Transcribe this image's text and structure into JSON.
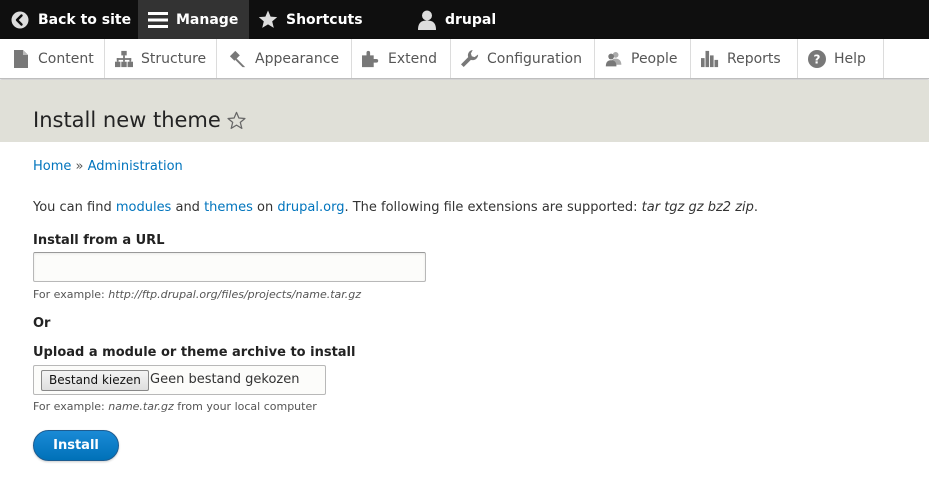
{
  "toolbar": {
    "back_label": "Back to site",
    "manage_label": "Manage",
    "shortcuts_label": "Shortcuts",
    "user_label": "drupal"
  },
  "tray": {
    "content": "Content",
    "structure": "Structure",
    "appearance": "Appearance",
    "extend": "Extend",
    "configuration": "Configuration",
    "people": "People",
    "reports": "Reports",
    "help": "Help"
  },
  "page": {
    "title": "Install new theme"
  },
  "breadcrumb": {
    "home": "Home",
    "separator": "»",
    "admin": "Administration"
  },
  "description": {
    "prefix": "You can find ",
    "modules_link": "modules",
    "and": " and ",
    "themes_link": "themes",
    "on": " on ",
    "drupal_link": "drupal.org",
    "suffix": ". The following file extensions are supported: ",
    "extensions": "tar tgz gz bz2 zip",
    "end": "."
  },
  "form": {
    "url_label": "Install from a URL",
    "url_value": "",
    "url_help_prefix": "For example: ",
    "url_help_example": "http://ftp.drupal.org/files/projects/name.tar.gz",
    "or_label": "Or",
    "upload_label": "Upload a module or theme archive to install",
    "file_button": "Bestand kiezen",
    "file_status": "Geen bestand gekozen",
    "upload_help_prefix": "For example: ",
    "upload_help_example": "name.tar.gz",
    "upload_help_suffix": " from your local computer",
    "install_button": "Install"
  },
  "colors": {
    "toolbar_bg": "#0f0f0f",
    "header_bg": "#e0e0d8",
    "link": "#0074bd",
    "primary_button": "#0071b8"
  }
}
